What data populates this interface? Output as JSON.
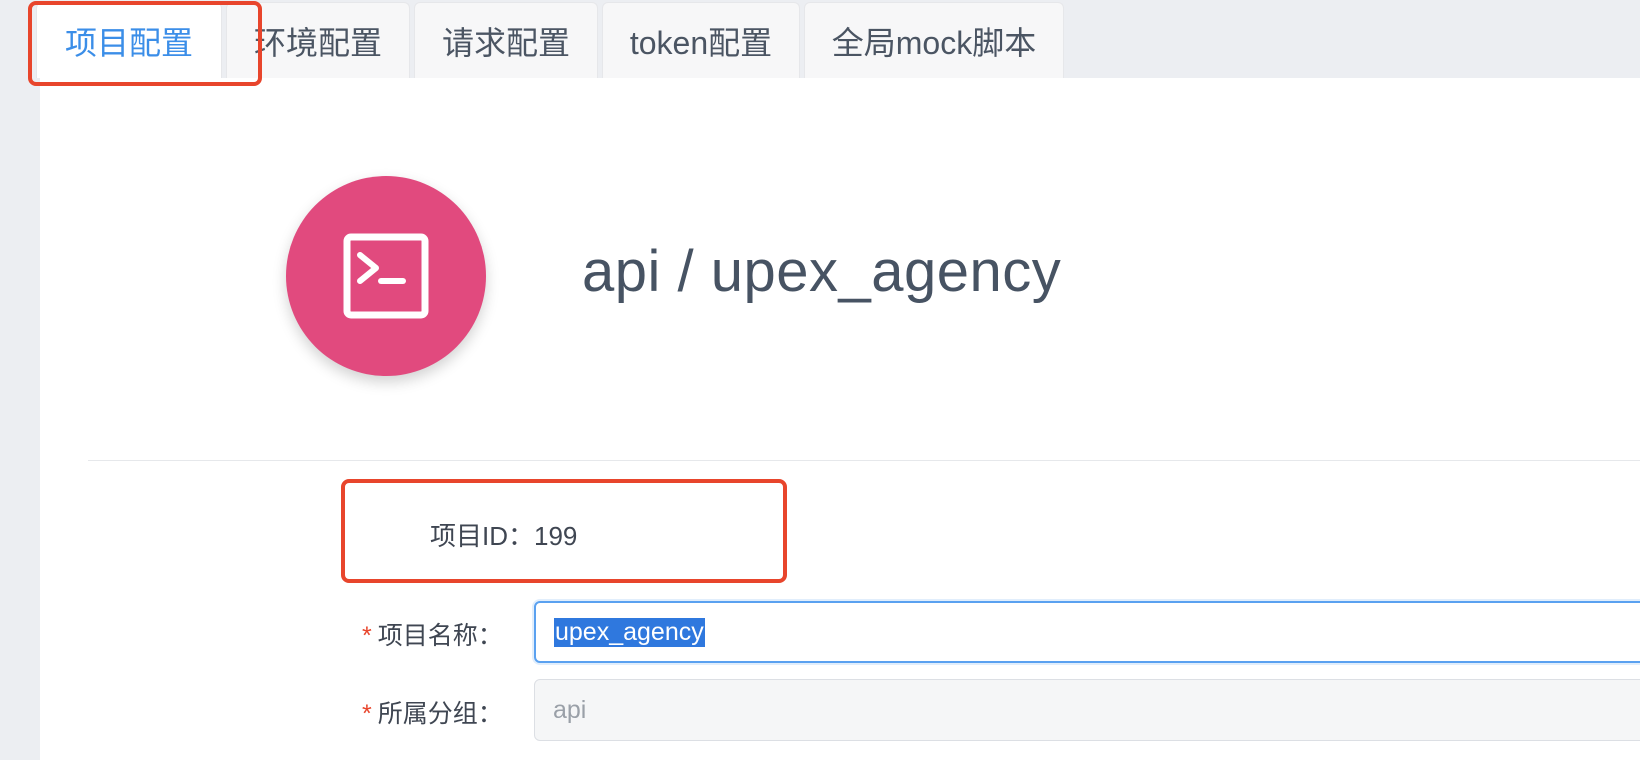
{
  "tabs": [
    {
      "label": "项目配置",
      "active": true
    },
    {
      "label": "环境配置",
      "active": false
    },
    {
      "label": "请求配置",
      "active": false
    },
    {
      "label": "token配置",
      "active": false
    },
    {
      "label": "全局mock脚本",
      "active": false
    }
  ],
  "project": {
    "icon": "terminal-icon",
    "logo_color": "#e14a7e",
    "title": "api / upex_agency"
  },
  "form": {
    "id_label": "项目ID：",
    "id_value": "199",
    "name_label": "项目名称：",
    "name_value": "upex_agency",
    "group_label": "所属分组：",
    "group_value": "api",
    "required_mark": "*"
  },
  "colors": {
    "accent": "#3b8ee8",
    "highlight": "#e8452c",
    "logo": "#e14a7e"
  }
}
